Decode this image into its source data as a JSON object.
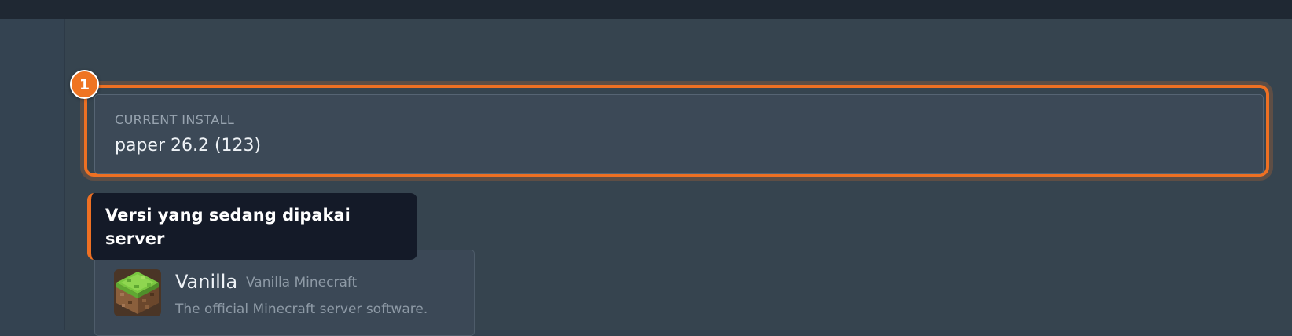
{
  "current_install": {
    "label": "CURRENT INSTALL",
    "value": "paper 26.2 (123)"
  },
  "tour": {
    "step_number": "1",
    "tooltip_text": "Versi yang sedang dipakai server",
    "accent_color": "#ee7023"
  },
  "software": {
    "items": [
      {
        "name": "Vanilla",
        "subtitle": "Vanilla Minecraft",
        "description": "The official Minecraft server software.",
        "icon": "grass-block-icon"
      }
    ]
  }
}
